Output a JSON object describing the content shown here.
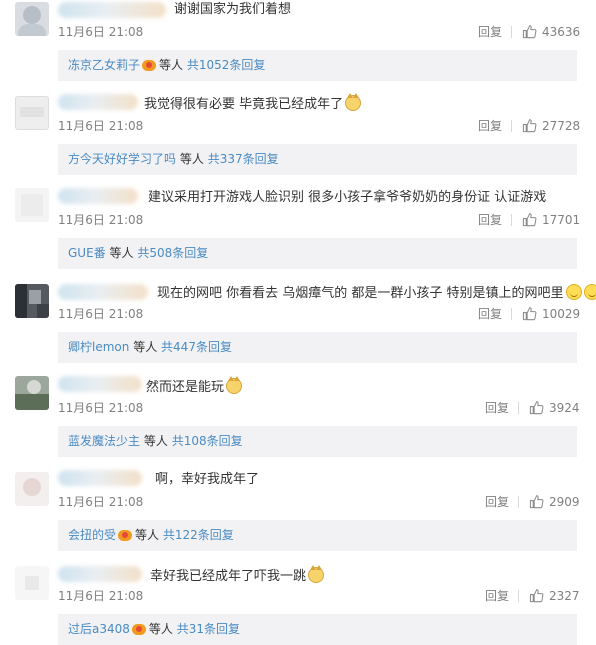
{
  "labels": {
    "reply": "回复",
    "others": "等人",
    "total_prefix": "共",
    "total_suffix": "条回复"
  },
  "comments": [
    {
      "text": "谢谢国家为我们着想",
      "emoji": "",
      "time": "11月6日 21:08",
      "likes": "43636",
      "sub_user": "冻京乙女莉子",
      "sub_badge": true,
      "sub_count": "1052"
    },
    {
      "text": "我觉得很有必要 毕竟我已经成年了",
      "emoji": "cat-face-icon",
      "time": "11月6日 21:08",
      "likes": "27728",
      "sub_user": "方今天好好学习了吗",
      "sub_badge": false,
      "sub_count": "337"
    },
    {
      "text": "建议采用打开游戏人脸识别  很多小孩子拿爷爷奶奶的身份证 认证游戏",
      "emoji": "",
      "time": "11月6日 21:08",
      "likes": "17701",
      "sub_user": "GUE番",
      "sub_badge": false,
      "sub_count": "508"
    },
    {
      "text": "现在的网吧 你看看去 乌烟瘴气的 都是一群小孩子 特别是镇上的网吧里",
      "emoji": "double-smile-icon",
      "time": "11月6日 21:08",
      "likes": "10029",
      "sub_user": "卿柠lemon",
      "sub_badge": false,
      "sub_count": "447"
    },
    {
      "text": "然而还是能玩",
      "emoji": "cat-face-icon",
      "time": "11月6日 21:08",
      "likes": "3924",
      "sub_user": "蓝发魔法少主",
      "sub_badge": false,
      "sub_count": "108"
    },
    {
      "text": "啊，幸好我成年了",
      "emoji": "",
      "time": "11月6日 21:08",
      "likes": "2909",
      "sub_user": "会扭的受",
      "sub_badge": true,
      "sub_count": "122"
    },
    {
      "text": "幸好我已经成年了吓我一跳",
      "emoji": "cat-face-icon",
      "time": "11月6日 21:08",
      "likes": "2327",
      "sub_user": "过后a3408",
      "sub_badge": true,
      "sub_count": "31"
    }
  ],
  "colors": {
    "link_blue": "#4a8bc2",
    "text": "#333333",
    "meta_gray": "#808080",
    "subbar_bg": "#f2f2f5"
  }
}
